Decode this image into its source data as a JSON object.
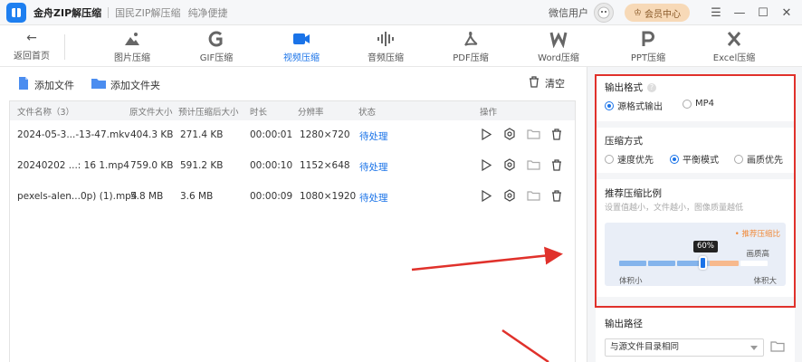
{
  "titlebar": {
    "app_name": "金舟ZIP解压缩",
    "slogans": [
      "国民ZIP解压缩",
      "纯净便捷"
    ],
    "user_label": "微信用户",
    "vip_label": "会员中心",
    "vip_icon": "crown-icon"
  },
  "toolbar": {
    "back_label": "返回首页",
    "tools": [
      {
        "label": "图片压缩",
        "icon": "image-compress-icon"
      },
      {
        "label": "GIF压缩",
        "icon": "gif-compress-icon"
      },
      {
        "label": "视频压缩",
        "icon": "video-compress-icon",
        "active": true
      },
      {
        "label": "音频压缩",
        "icon": "audio-compress-icon"
      },
      {
        "label": "PDF压缩",
        "icon": "pdf-compress-icon"
      },
      {
        "label": "Word压缩",
        "icon": "word-compress-icon"
      },
      {
        "label": "PPT压缩",
        "icon": "ppt-compress-icon"
      },
      {
        "label": "Excel压缩",
        "icon": "excel-compress-icon"
      }
    ]
  },
  "file_actions": {
    "add_file": "添加文件",
    "add_folder": "添加文件夹",
    "clear": "清空"
  },
  "table": {
    "columns": [
      "文件名称（3）",
      "原文件大小",
      "预计压缩后大小",
      "时长",
      "分辨率",
      "状态",
      "操作"
    ],
    "rows": [
      {
        "name": "2024-05-3...-13-47.mkv",
        "size": "404.3 KB",
        "est": "271.4 KB",
        "duration": "00:00:01",
        "resolution": "1280×720",
        "status": "待处理"
      },
      {
        "name": "20240202 ...: 16 1.mp4",
        "size": "759.0 KB",
        "est": "591.2 KB",
        "duration": "00:00:10",
        "resolution": "1152×648",
        "status": "待处理"
      },
      {
        "name": "pexels-alen...0p) (1).mp4",
        "size": "5.8 MB",
        "est": "3.6 MB",
        "duration": "00:00:09",
        "resolution": "1080×1920",
        "status": "待处理"
      }
    ]
  },
  "settings": {
    "format": {
      "title": "输出格式",
      "options": [
        {
          "label": "源格式输出",
          "selected": true
        },
        {
          "label": "MP4",
          "selected": false
        }
      ]
    },
    "mode": {
      "title": "压缩方式",
      "options": [
        {
          "label": "速度优先",
          "selected": false
        },
        {
          "label": "平衡模式",
          "selected": true
        },
        {
          "label": "画质优先",
          "selected": false
        }
      ]
    },
    "ratio": {
      "title": "推荐压缩比例",
      "subtitle": "设置值越小，文件越小，图像质量越低",
      "hint": "• 推荐压缩比",
      "value_label": "60%",
      "value": 0.6,
      "left_label": "体积小",
      "right_label": "体积大",
      "quality_label": "画质高"
    },
    "output": {
      "title": "输出路径",
      "selected": "与源文件目录相同"
    }
  },
  "colors": {
    "accent": "#1a73e8",
    "annotation": "#e0312b",
    "recommend": "#f08a3a"
  }
}
